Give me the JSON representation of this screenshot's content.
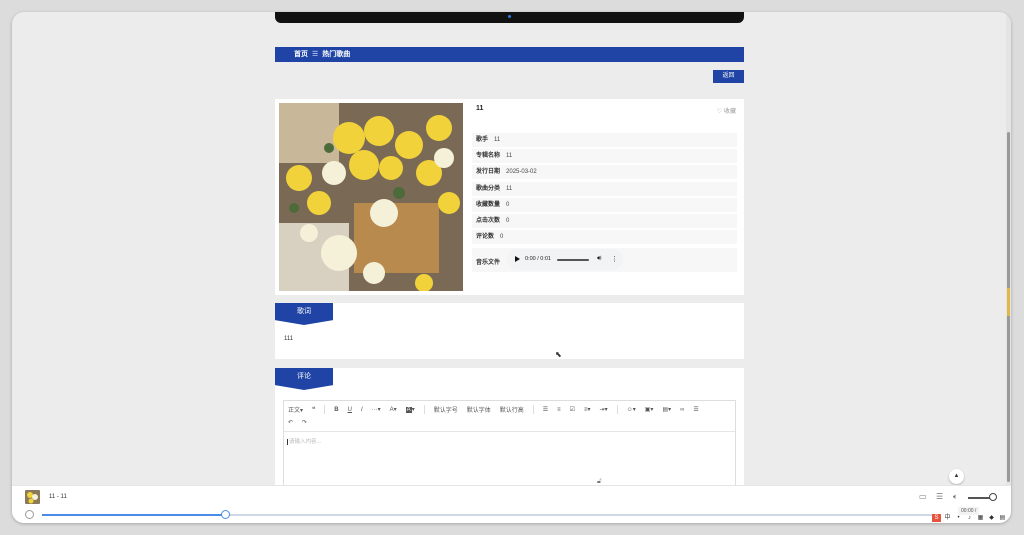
{
  "breadcrumb": {
    "home": "首页",
    "separator": "☰",
    "current": "热门歌曲"
  },
  "back_button": "返回",
  "song": {
    "title": "11",
    "favorite_label": "收藏",
    "fields": [
      {
        "label": "歌手",
        "value": "11"
      },
      {
        "label": "专辑名称",
        "value": "11"
      },
      {
        "label": "发行日期",
        "value": "2025-03-02"
      },
      {
        "label": "歌曲分类",
        "value": "11"
      },
      {
        "label": "收藏数量",
        "value": "0"
      },
      {
        "label": "点击次数",
        "value": "0"
      },
      {
        "label": "评论数",
        "value": "0"
      }
    ],
    "music_label": "音乐文件",
    "audio_time": "0:00 / 0:01"
  },
  "lyrics": {
    "tab": "歌词",
    "text": "111"
  },
  "comments": {
    "tab": "评论",
    "toolbar": {
      "paragraph": "正文",
      "quote": "❝",
      "bold": "B",
      "underline": "U",
      "italic": "I",
      "more": "···",
      "font_color": "A",
      "bg_color": "A",
      "font_size": "默认字号",
      "font_family": "默认字体",
      "line_height": "默认行高",
      "undo": "↶",
      "redo": "↷"
    },
    "placeholder": "请输入内容..."
  },
  "player_bar": {
    "now_playing": "11 - 11",
    "volume_time": "00:00 /"
  },
  "colors": {
    "primary": "#1f44a5",
    "progress": "#4a8be8"
  }
}
